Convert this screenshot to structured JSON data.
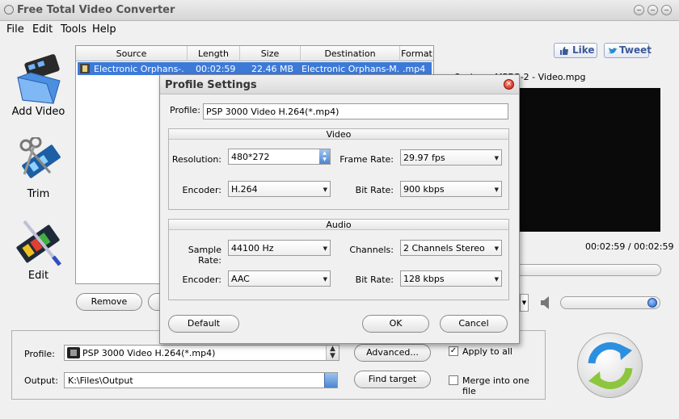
{
  "window": {
    "title": "Free Total Video Converter"
  },
  "menu": [
    "File",
    "Edit",
    "Tools",
    "Help"
  ],
  "sidebar": {
    "add_video": "Add Video",
    "trim": "Trim",
    "edit": "Edit"
  },
  "file_table": {
    "headers": [
      "Source",
      "Length",
      "Size",
      "Destination",
      "Format"
    ],
    "rows": [
      {
        "source": "Electronic Orphans-...",
        "length": "00:02:59",
        "size": "22.46 MB",
        "destination": "Electronic Orphans-M...",
        "format": ".mp4"
      }
    ]
  },
  "list_buttons": {
    "remove": "Remove"
  },
  "social": {
    "like": "Like",
    "tweet": "Tweet"
  },
  "preview": {
    "filename": "c Orphans-MPEG-2 - Video.mpg",
    "timecode": "00:02:59 / 00:02:59"
  },
  "bottom": {
    "profile_label": "Profile:",
    "profile_value": "PSP 3000 Video H.264(*.mp4)",
    "advanced": "Advanced...",
    "apply_to_all": "Apply to all",
    "apply_checked": true,
    "output_label": "Output:",
    "output_value": "K:\\Files\\Output",
    "find_target": "Find target",
    "merge": "Merge into one file"
  },
  "dialog": {
    "title": "Profile Settings",
    "profile_label": "Profile:",
    "profile_value": "PSP 3000 Video H.264(*.mp4)",
    "video_group": "Video",
    "resolution_label": "Resolution:",
    "resolution_value": "480*272",
    "frame_rate_label": "Frame Rate:",
    "frame_rate_value": "29.97 fps",
    "encoder_label": "Encoder:",
    "video_encoder_value": "H.264",
    "bit_rate_label": "Bit Rate:",
    "video_bit_rate_value": "900 kbps",
    "audio_group": "Audio",
    "sample_rate_label": "Sample Rate:",
    "sample_rate_value": "44100 Hz",
    "channels_label": "Channels:",
    "channels_value": "2 Channels Stereo",
    "audio_encoder_value": "AAC",
    "audio_bit_rate_value": "128 kbps",
    "default_btn": "Default",
    "ok_btn": "OK",
    "cancel_btn": "Cancel"
  }
}
